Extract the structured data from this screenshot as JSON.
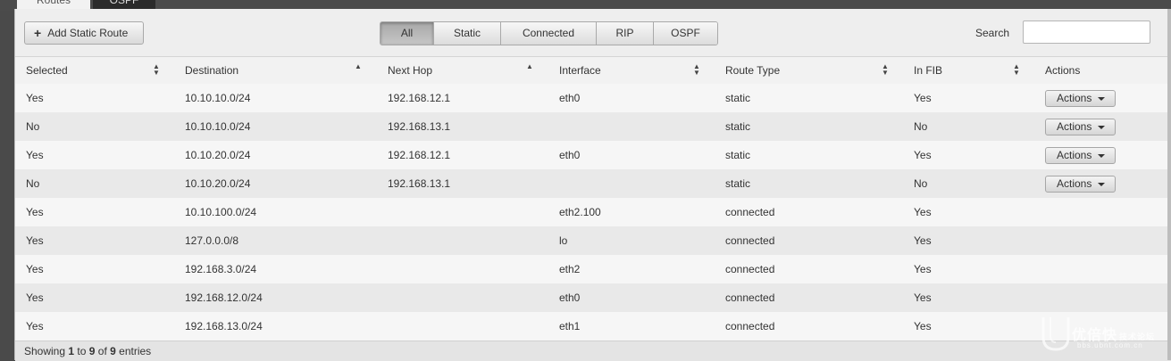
{
  "tabs": [
    {
      "label": "Routes",
      "active": true
    },
    {
      "label": "OSPF",
      "active": false
    }
  ],
  "toolbar": {
    "add_label": "Add Static Route",
    "add_icon": "plus-icon",
    "filters": [
      {
        "label": "All",
        "active": true
      },
      {
        "label": "Static",
        "active": false
      },
      {
        "label": "Connected",
        "active": false
      },
      {
        "label": "RIP",
        "active": false
      },
      {
        "label": "OSPF",
        "active": false
      }
    ],
    "search_label": "Search",
    "search_value": ""
  },
  "table": {
    "columns": [
      {
        "label": "Selected",
        "sort": "both"
      },
      {
        "label": "Destination",
        "sort": "asc"
      },
      {
        "label": "Next Hop",
        "sort": "asc"
      },
      {
        "label": "Interface",
        "sort": "both"
      },
      {
        "label": "Route Type",
        "sort": "both"
      },
      {
        "label": "In FIB",
        "sort": "both"
      },
      {
        "label": "Actions",
        "sort": "none"
      }
    ],
    "rows": [
      {
        "selected": "Yes",
        "destination": "10.10.10.0/24",
        "next_hop": "192.168.12.1",
        "interface": "eth0",
        "route_type": "static",
        "in_fib": "Yes",
        "action": "Actions"
      },
      {
        "selected": "No",
        "destination": "10.10.10.0/24",
        "next_hop": "192.168.13.1",
        "interface": "",
        "route_type": "static",
        "in_fib": "No",
        "action": "Actions"
      },
      {
        "selected": "Yes",
        "destination": "10.10.20.0/24",
        "next_hop": "192.168.12.1",
        "interface": "eth0",
        "route_type": "static",
        "in_fib": "Yes",
        "action": "Actions"
      },
      {
        "selected": "No",
        "destination": "10.10.20.0/24",
        "next_hop": "192.168.13.1",
        "interface": "",
        "route_type": "static",
        "in_fib": "No",
        "action": "Actions"
      },
      {
        "selected": "Yes",
        "destination": "10.10.100.0/24",
        "next_hop": "",
        "interface": "eth2.100",
        "route_type": "connected",
        "in_fib": "Yes",
        "action": ""
      },
      {
        "selected": "Yes",
        "destination": "127.0.0.0/8",
        "next_hop": "",
        "interface": "lo",
        "route_type": "connected",
        "in_fib": "Yes",
        "action": ""
      },
      {
        "selected": "Yes",
        "destination": "192.168.3.0/24",
        "next_hop": "",
        "interface": "eth2",
        "route_type": "connected",
        "in_fib": "Yes",
        "action": ""
      },
      {
        "selected": "Yes",
        "destination": "192.168.12.0/24",
        "next_hop": "",
        "interface": "eth0",
        "route_type": "connected",
        "in_fib": "Yes",
        "action": ""
      },
      {
        "selected": "Yes",
        "destination": "192.168.13.0/24",
        "next_hop": "",
        "interface": "eth1",
        "route_type": "connected",
        "in_fib": "Yes",
        "action": ""
      }
    ]
  },
  "footer": {
    "prefix": "Showing ",
    "start": "1",
    "to": " to ",
    "end": "9",
    "of": " of ",
    "total": "9",
    "suffix": " entries"
  },
  "watermark": {
    "main": "优倍快",
    "tag": "技术论坛",
    "url": "bbs.ubnt.com.cn"
  }
}
